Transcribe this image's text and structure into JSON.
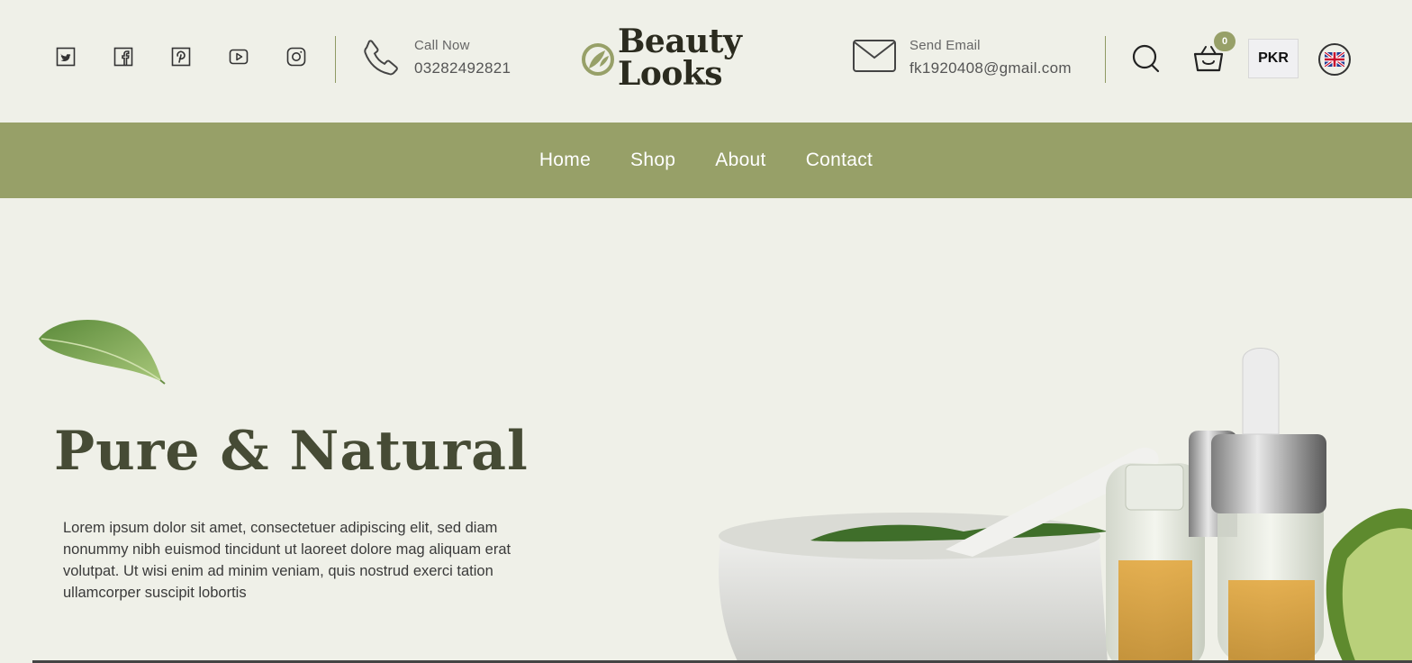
{
  "header": {
    "socials": [
      "twitter-icon",
      "facebook-icon",
      "pinterest-icon",
      "youtube-icon",
      "instagram-icon"
    ],
    "phone": {
      "label": "Call Now",
      "value": "03282492821"
    },
    "logo": {
      "line1": "Beauty",
      "line2": "Looks"
    },
    "email": {
      "label": "Send Email",
      "value": "fk1920408@gmail.com"
    },
    "cart_count": "0",
    "currency": "PKR",
    "language_icon": "uk-flag-icon"
  },
  "nav": {
    "items": [
      "Home",
      "Shop",
      "About",
      "Contact"
    ]
  },
  "hero": {
    "title": "Pure & Natural",
    "text": "Lorem ipsum dolor sit amet, consectetuer adipiscing elit, sed diam nonummy nibh euismod tincidunt ut laoreet dolore mag aliquam erat volutpat. Ut wisi enim ad minim veniam, quis nostrud exerci tation ullamcorper suscipit lobortis"
  },
  "colors": {
    "accent": "#97a068",
    "background": "#eff0e8",
    "title": "#464b35",
    "logo": "#2b2b1f"
  }
}
